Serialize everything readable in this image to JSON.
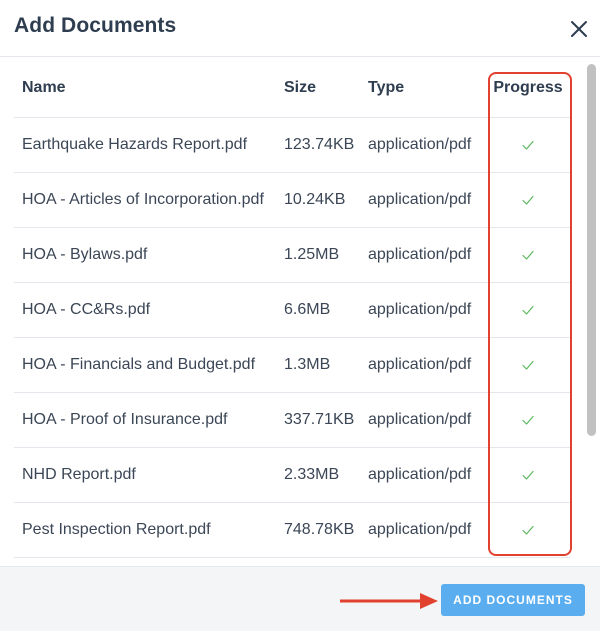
{
  "dialog": {
    "title": "Add Documents",
    "close_icon": "close-icon"
  },
  "table": {
    "headers": {
      "name": "Name",
      "size": "Size",
      "type": "Type",
      "progress": "Progress"
    },
    "rows": [
      {
        "name": "Earthquake Hazards Report.pdf",
        "size": "123.74KB",
        "type": "application/pdf",
        "progress": "complete"
      },
      {
        "name": "HOA - Articles of Incorporation.pdf",
        "size": "10.24KB",
        "type": "application/pdf",
        "progress": "complete"
      },
      {
        "name": "HOA - Bylaws.pdf",
        "size": "1.25MB",
        "type": "application/pdf",
        "progress": "complete"
      },
      {
        "name": "HOA - CC&Rs.pdf",
        "size": "6.6MB",
        "type": "application/pdf",
        "progress": "complete"
      },
      {
        "name": "HOA - Financials and Budget.pdf",
        "size": "1.3MB",
        "type": "application/pdf",
        "progress": "complete"
      },
      {
        "name": "HOA - Proof of Insurance.pdf",
        "size": "337.71KB",
        "type": "application/pdf",
        "progress": "complete"
      },
      {
        "name": "NHD Report.pdf",
        "size": "2.33MB",
        "type": "application/pdf",
        "progress": "complete"
      },
      {
        "name": "Pest Inspection Report.pdf",
        "size": "748.78KB",
        "type": "application/pdf",
        "progress": "complete"
      }
    ],
    "progress_icon": "check-icon"
  },
  "footer": {
    "add_button_label": "ADD DOCUMENTS"
  },
  "colors": {
    "accent_button": "#5aaef0",
    "check": "#5cb85c",
    "annotation": "#e0422f",
    "title_text": "#2e3d4f"
  }
}
